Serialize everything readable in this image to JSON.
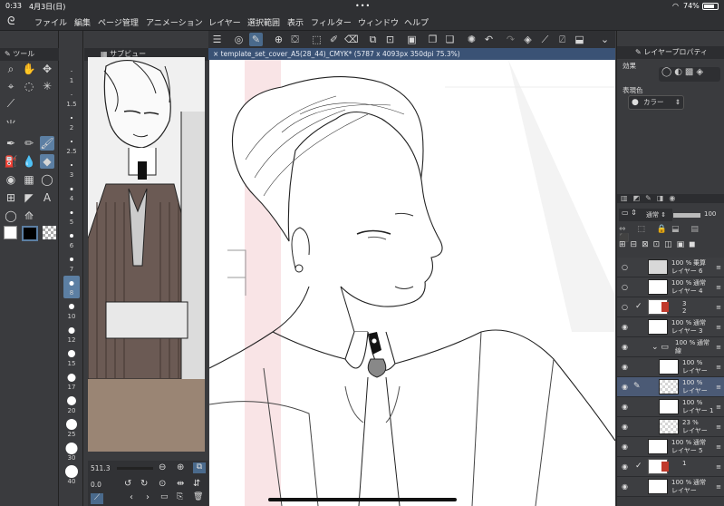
{
  "status": {
    "time": "0:33",
    "date": "4月3日(日)",
    "battery": "74%"
  },
  "menu": [
    "ファイル",
    "編集",
    "ページ管理",
    "アニメーション",
    "レイヤー",
    "選択範囲",
    "表示",
    "フィルター",
    "ウィンドウ",
    "ヘルプ"
  ],
  "left_panel": {
    "title": "ツール"
  },
  "brush_sizes": [
    "1",
    "1.5",
    "2",
    "2.5",
    "3",
    "4",
    "5",
    "6",
    "7",
    "8",
    "10",
    "12",
    "15",
    "17",
    "20",
    "25",
    "30",
    "40"
  ],
  "selected_brush_size": "8",
  "sub_panel": {
    "title": "サブビュー",
    "zoom": "511.3",
    "rotation": "0.0"
  },
  "document": {
    "tab": "template_set_cover_A5(28_44)_CMYK* (5787 x 4093px 350dpi 75.3%)"
  },
  "layer_property": {
    "title": "レイヤープロパティ",
    "effect_label": "効果",
    "expression_label": "表現色",
    "expression_value": "カラー"
  },
  "layer_panel": {
    "blend_mode": "通常",
    "opacity": "100",
    "layers": [
      {
        "opacity": "100 %",
        "mode": "乗算",
        "name": "レイヤー 6",
        "thumb": "sketch"
      },
      {
        "opacity": "100 %",
        "mode": "通常",
        "name": "レイヤー 4",
        "thumb": "white"
      },
      {
        "opacity": "",
        "mode": "",
        "name": "",
        "thumb": "mask",
        "mask_label": "3\n2"
      },
      {
        "opacity": "100 %",
        "mode": "通常",
        "name": "レイヤー 3",
        "thumb": "white"
      },
      {
        "opacity": "100 %",
        "mode": "通常",
        "name": "線",
        "thumb": "folder"
      },
      {
        "opacity": "100 %",
        "mode": "",
        "name": "レイヤー",
        "thumb": "white"
      },
      {
        "opacity": "100 %",
        "mode": "",
        "name": "レイヤー",
        "thumb": "checker"
      },
      {
        "opacity": "100 %",
        "mode": "",
        "name": "レイヤー 1",
        "thumb": "white"
      },
      {
        "opacity": "23 %",
        "mode": "",
        "name": "レイヤー",
        "thumb": "checker"
      },
      {
        "opacity": "100 %",
        "mode": "通常",
        "name": "レイヤー 5",
        "thumb": "white"
      },
      {
        "opacity": "",
        "mode": "",
        "name": "",
        "thumb": "mask",
        "mask_label": "1"
      },
      {
        "opacity": "100 %",
        "mode": "通常",
        "name": "レイヤー",
        "thumb": "white"
      }
    ]
  },
  "colors": {
    "accent": "#5c7fa3",
    "panel": "#3a3b3e",
    "tab": "#3a5275"
  }
}
